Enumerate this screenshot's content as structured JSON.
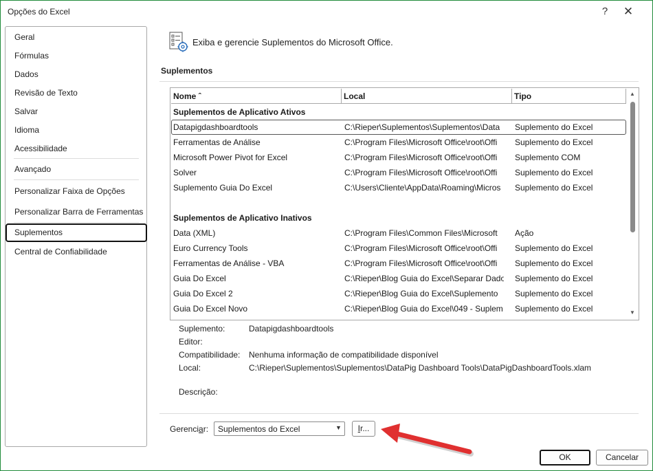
{
  "window": {
    "title": "Opções do Excel",
    "help": "?",
    "close": "✕"
  },
  "nav": {
    "items": [
      {
        "label": "Geral"
      },
      {
        "label": "Fórmulas"
      },
      {
        "label": "Dados"
      },
      {
        "label": "Revisão de Texto"
      },
      {
        "label": "Salvar"
      },
      {
        "label": "Idioma"
      },
      {
        "label": "Acessibilidade"
      },
      {
        "label": "Avançado"
      },
      {
        "label": "Personalizar Faixa de Opções"
      },
      {
        "label": "Personalizar Barra de Ferramentas"
      },
      {
        "label": "Suplementos"
      },
      {
        "label": "Central de Confiabilidade"
      }
    ],
    "selected": "Suplementos"
  },
  "header": {
    "text": "Exiba e gerencie Suplementos do Microsoft Office.",
    "icon": "addins-gear-icon"
  },
  "section": {
    "title": "Suplementos"
  },
  "table": {
    "columns": [
      "Nome ˆ",
      "Local",
      "Tipo"
    ],
    "group_active": "Suplementos de Aplicativo Ativos",
    "active": [
      {
        "name": "Datapigdashboardtools",
        "location": "C:\\Rieper\\Suplementos\\Suplementos\\Data",
        "type": "Suplemento do Excel"
      },
      {
        "name": "Ferramentas de Análise",
        "location": "C:\\Program Files\\Microsoft Office\\root\\Offi",
        "type": "Suplemento do Excel"
      },
      {
        "name": "Microsoft Power Pivot for Excel",
        "location": "C:\\Program Files\\Microsoft Office\\root\\Offi",
        "type": "Suplemento COM"
      },
      {
        "name": "Solver",
        "location": "C:\\Program Files\\Microsoft Office\\root\\Offi",
        "type": "Suplemento do Excel"
      },
      {
        "name": "Suplemento Guia Do Excel",
        "location": "C:\\Users\\Cliente\\AppData\\Roaming\\Micros",
        "type": "Suplemento do Excel"
      }
    ],
    "group_inactive": "Suplementos de Aplicativo Inativos",
    "inactive": [
      {
        "name": "Data (XML)",
        "location": "C:\\Program Files\\Common Files\\Microsoft",
        "type": "Ação"
      },
      {
        "name": "Euro Currency Tools",
        "location": "C:\\Program Files\\Microsoft Office\\root\\Offi",
        "type": "Suplemento do Excel"
      },
      {
        "name": "Ferramentas de Análise - VBA",
        "location": "C:\\Program Files\\Microsoft Office\\root\\Offi",
        "type": "Suplemento do Excel"
      },
      {
        "name": "Guia Do Excel",
        "location": "C:\\Rieper\\Blog Guia do Excel\\Separar Dado",
        "type": "Suplemento do Excel"
      },
      {
        "name": "Guia Do Excel 2",
        "location": "C:\\Rieper\\Blog Guia do Excel\\Suplemento",
        "type": "Suplemento do Excel"
      },
      {
        "name": "Guia Do Excel Novo",
        "location": "C:\\Rieper\\Blog Guia do Excel\\049 - Suplem",
        "type": "Suplemento do Excel"
      }
    ]
  },
  "details": {
    "addin_label": "Suplemento:",
    "addin_value": "Datapigdashboardtools",
    "editor_label": "Editor:",
    "editor_value": "",
    "compat_label": "Compatibilidade:",
    "compat_value": "Nenhuma informação de compatibilidade disponível",
    "location_label": "Local:",
    "location_value": "C:\\Rieper\\Suplementos\\Suplementos\\DataPig Dashboard Tools\\DataPigDashboardTools.xlam",
    "desc_label": "Descrição:",
    "desc_value": ""
  },
  "manage": {
    "label_pre": "Gerenci",
    "label_ul": "a",
    "label_post": "r:",
    "selected": "Suplementos do Excel",
    "go_ul": "I",
    "go_rest": "r..."
  },
  "buttons": {
    "ok": "OK",
    "cancel": "Cancelar"
  },
  "colors": {
    "arrow": "#e03030",
    "window_border": "#1f8a3a"
  }
}
